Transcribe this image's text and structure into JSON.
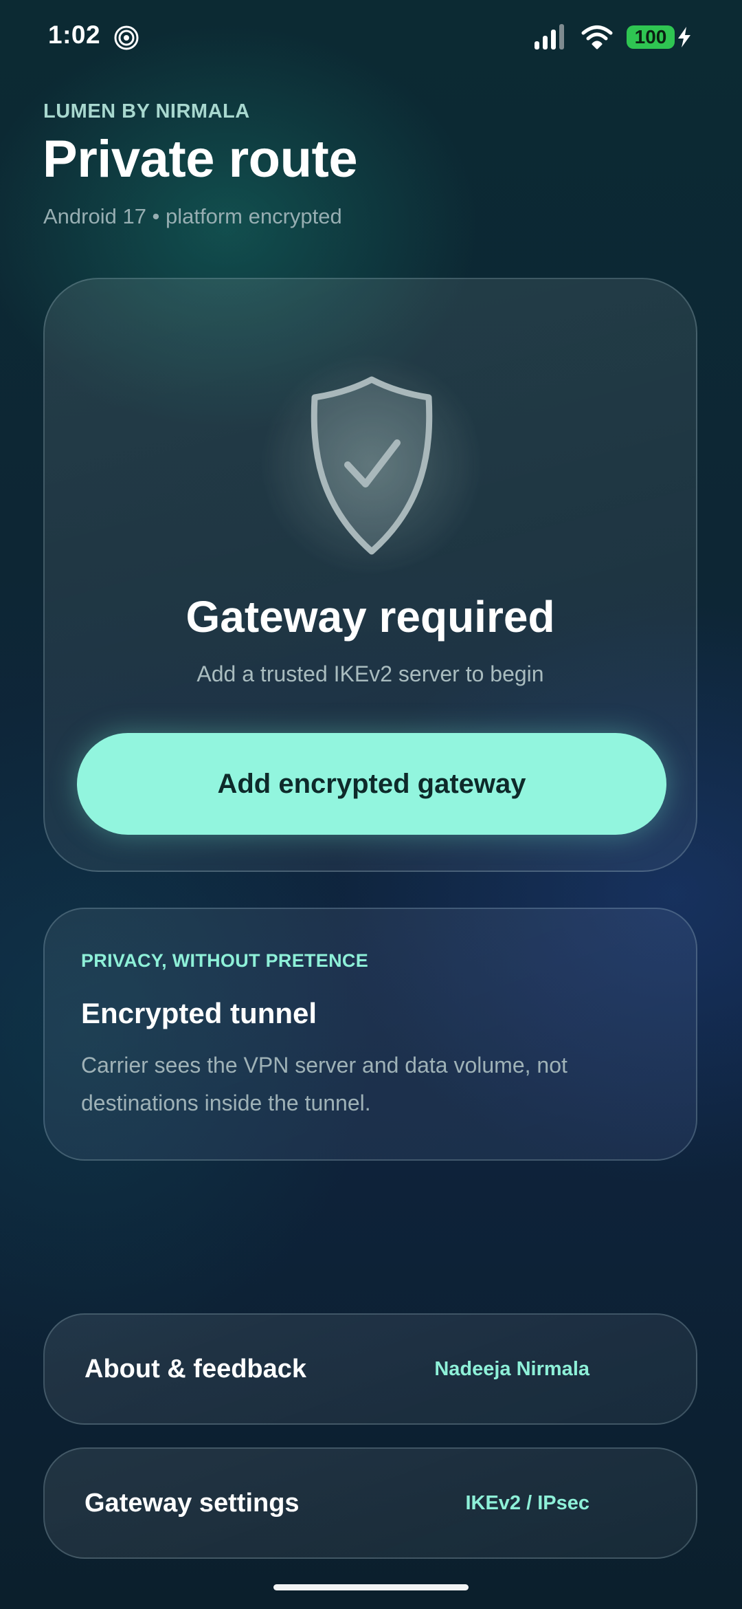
{
  "status_bar": {
    "time": "1:02",
    "battery_level": "100",
    "app_icon": "spiral-icon",
    "signal_icon": "cellular-signal-icon",
    "wifi_icon": "wifi-icon",
    "charging_icon": "bolt-icon"
  },
  "header": {
    "brand": "LUMEN BY NIRMALA",
    "title": "Private route",
    "subtitle": "Android 17 • platform encrypted"
  },
  "hero": {
    "icon": "shield-check-icon",
    "title": "Gateway required",
    "subtitle": "Add a trusted IKEv2 server to begin",
    "button_label": "Add encrypted gateway"
  },
  "info": {
    "eyebrow": "PRIVACY, WITHOUT PRETENCE",
    "title": "Encrypted tunnel",
    "body": "Carrier sees the VPN server and data volume, not destinations inside the tunnel."
  },
  "rows": {
    "about": {
      "label": "About & feedback",
      "value": "Nadeeja Nirmala"
    },
    "gateway": {
      "label": "Gateway settings",
      "value": "IKEv2 / IPsec"
    }
  },
  "colors": {
    "accent": "#92f5de",
    "accent_text": "#8ef0d8",
    "battery": "#2fc552",
    "background": "#0d2634"
  }
}
